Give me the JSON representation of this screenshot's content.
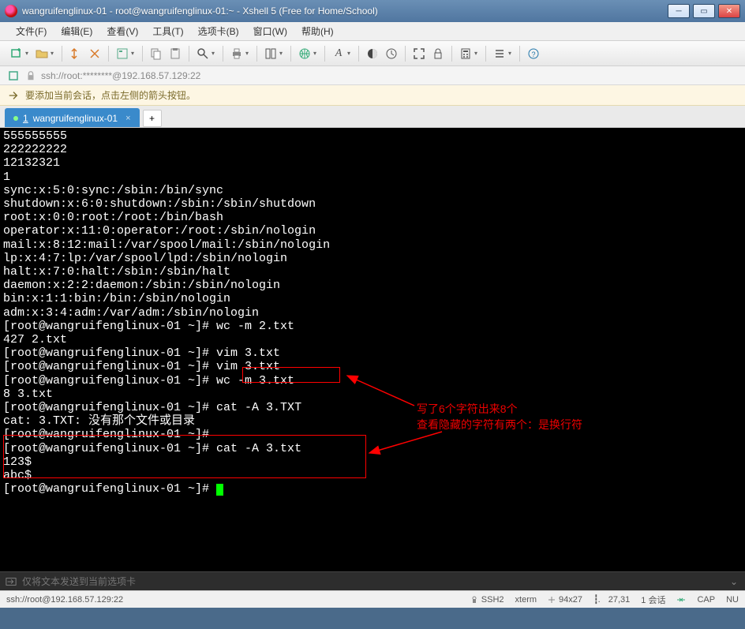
{
  "window": {
    "title": "wangruifenglinux-01 - root@wangruifenglinux-01:~ - Xshell 5 (Free for Home/School)"
  },
  "menu": {
    "file": "文件(F)",
    "edit": "编辑(E)",
    "view": "查看(V)",
    "tools": "工具(T)",
    "tabs": "选项卡(B)",
    "window": "窗口(W)",
    "help": "帮助(H)"
  },
  "address": {
    "url": "ssh://root:********@192.168.57.129:22"
  },
  "infobar": {
    "text": "要添加当前会话，点击左侧的箭头按钮。"
  },
  "tab": {
    "index": "1",
    "label": "wangruifenglinux-01",
    "new": "+"
  },
  "terminal": {
    "l0": "555555555",
    "l1": "222222222",
    "l2": "12132321",
    "l3": "1",
    "l4": "sync:x:5:0:sync:/sbin:/bin/sync",
    "l5": "shutdown:x:6:0:shutdown:/sbin:/sbin/shutdown",
    "l6": "root:x:0:0:root:/root:/bin/bash",
    "l7": "operator:x:11:0:operator:/root:/sbin/nologin",
    "l8": "mail:x:8:12:mail:/var/spool/mail:/sbin/nologin",
    "l9": "lp:x:4:7:lp:/var/spool/lpd:/sbin/nologin",
    "l10": "halt:x:7:0:halt:/sbin:/sbin/halt",
    "l11": "daemon:x:2:2:daemon:/sbin:/sbin/nologin",
    "l12": "bin:x:1:1:bin:/bin:/sbin/nologin",
    "l13": "adm:x:3:4:adm:/var/adm:/sbin/nologin",
    "p14": "[root@wangruifenglinux-01 ~]# ",
    "c14": "wc -m 2.txt",
    "l15": "427 2.txt",
    "p16": "[root@wangruifenglinux-01 ~]# ",
    "c16": "vim 3.txt",
    "p17": "[root@wangruifenglinux-01 ~]# ",
    "c17": "vim 3.txt",
    "p18": "[root@wangruifenglinux-01 ~]# ",
    "c18": "wc -m 3.txt",
    "l19": "8 3.txt",
    "p20": "[root@wangruifenglinux-01 ~]# ",
    "c20": "cat -A 3.TXT",
    "l21": "cat: 3.TXT: 没有那个文件或目录",
    "p22": "[root@wangruifenglinux-01 ~]# ",
    "p23": "[root@wangruifenglinux-01 ~]# ",
    "c23": "cat -A 3.txt",
    "l24": "123$",
    "l25": "abc$",
    "p26": "[root@wangruifenglinux-01 ~]# "
  },
  "annotation": {
    "line1": "写了6个字符出来8个",
    "line2": "查看隐藏的字符有两个：是换行符"
  },
  "bottominput": {
    "placeholder": "仅将文本发送到当前选项卡"
  },
  "status": {
    "left": "ssh://root@192.168.57.129:22",
    "ssh": "SSH2",
    "term": "xterm",
    "size": "94x27",
    "pos": "27,31",
    "sessions": "1 会话",
    "cap": "CAP",
    "num": "NU"
  }
}
